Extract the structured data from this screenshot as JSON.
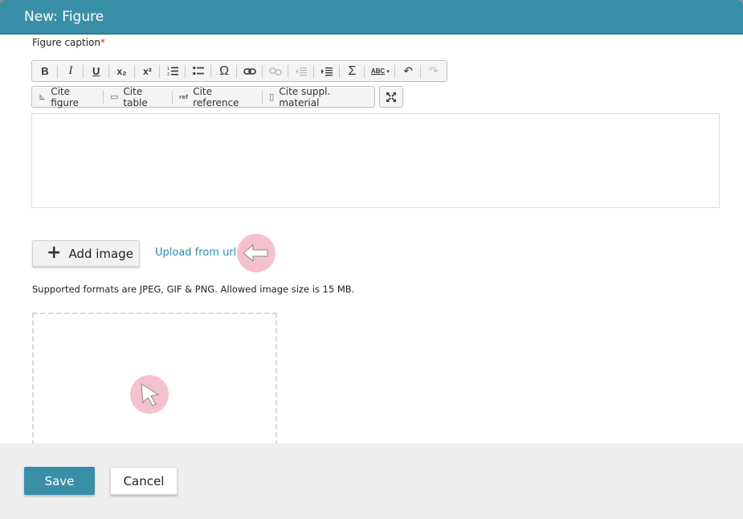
{
  "dialog": {
    "title": "New: Figure"
  },
  "caption": {
    "label": "Figure caption",
    "required_mark": "*"
  },
  "toolbar": {
    "bold": "B",
    "italic": "I",
    "underline": "U",
    "subscript": "x₂",
    "superscript": "x²",
    "omega": "Ω",
    "sigma": "Σ",
    "spellcheck": "ABC"
  },
  "cite_toolbar": {
    "cite_figure": "Cite figure",
    "cite_table": "Cite table",
    "cite_reference": "Cite reference",
    "cite_suppl": "Cite suppl. material",
    "ref_badge": "ref"
  },
  "upload": {
    "add_image": "Add image",
    "upload_from_url": "Upload from url",
    "formats_hint": "Supported formats are JPEG, GIF & PNG. Allowed image size is 15 MB."
  },
  "footer": {
    "save": "Save",
    "cancel": "Cancel"
  },
  "colors": {
    "accent": "#3a8fa8",
    "link": "#2b8cab",
    "hint": "#f0a0b4"
  }
}
